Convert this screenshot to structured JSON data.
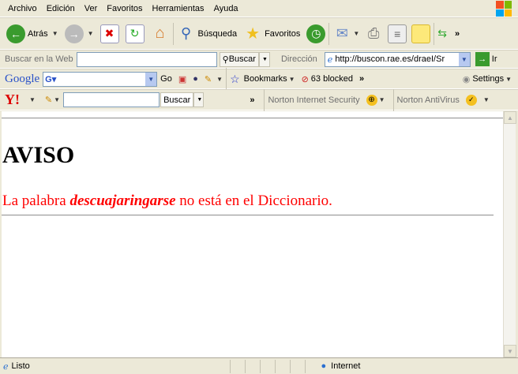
{
  "menu": [
    "Archivo",
    "Edición",
    "Ver",
    "Favoritos",
    "Herramientas",
    "Ayuda"
  ],
  "toolbar": {
    "back": "Atrás",
    "search": "Búsqueda",
    "favorites": "Favoritos"
  },
  "searchbar": {
    "label": "Buscar en la Web",
    "value": "",
    "button": "Buscar",
    "address_label": "Dirección",
    "address": "http://buscon.rae.es/draeI/Sr",
    "go": "Ir"
  },
  "google": {
    "logo": "Google",
    "go": "Go",
    "bookmarks": "Bookmarks",
    "blocked": "63 blocked",
    "settings": "Settings"
  },
  "yahoo": {
    "logo": "Y!",
    "button": "Buscar",
    "norton_security": "Norton Internet Security",
    "norton_av": "Norton AntiVirus"
  },
  "page": {
    "heading": "AVISO",
    "msg_before": "La palabra ",
    "word": "descuajaringarse",
    "msg_after": " no está en el Diccionario.",
    "msg_color": "#ff0000"
  },
  "status": {
    "text": "Listo",
    "zone": "Internet"
  }
}
